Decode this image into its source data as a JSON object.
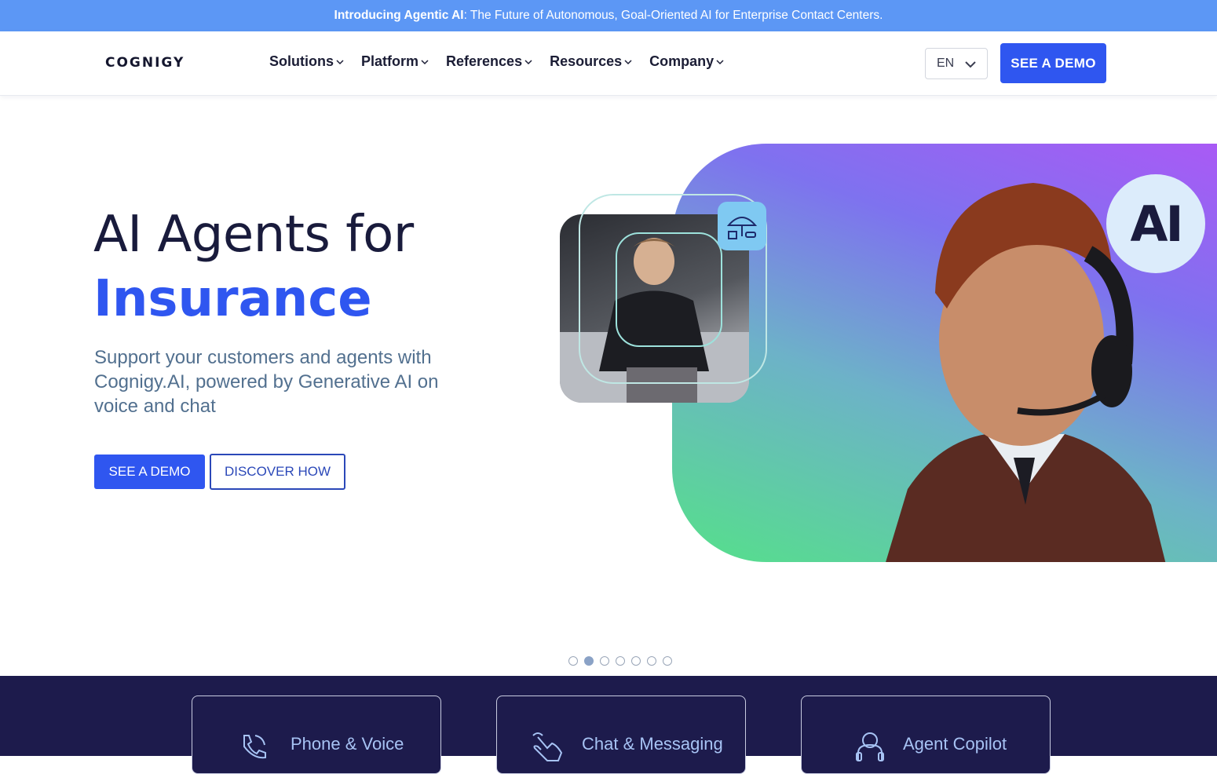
{
  "announcement": {
    "bold": "Introducing Agentic AI",
    "rest": ": The Future of Autonomous, Goal-Oriented AI for Enterprise Contact Centers."
  },
  "header": {
    "logo": "COGNIGY",
    "nav": [
      {
        "label": "Solutions"
      },
      {
        "label": "Platform"
      },
      {
        "label": "References"
      },
      {
        "label": "Resources"
      },
      {
        "label": "Company"
      }
    ],
    "language": "EN",
    "demo_label": "SEE A DEMO"
  },
  "hero": {
    "title": "AI Agents for",
    "accent": "Insurance",
    "subtitle": "Support your customers and agents with Cognigy.AI, powered by Generative AI on voice and chat",
    "primary_cta": "SEE A DEMO",
    "secondary_cta": "DISCOVER HOW",
    "badge": "AI"
  },
  "carousel": {
    "count": 7,
    "active_index": 1
  },
  "cards": [
    {
      "label": "Phone & Voice",
      "icon": "phone-icon"
    },
    {
      "label": "Chat & Messaging",
      "icon": "tap-hand-icon"
    },
    {
      "label": "Agent Copilot",
      "icon": "headset-ai-icon"
    }
  ],
  "colors": {
    "primary": "#2f56f0",
    "navy": "#1d1b4c",
    "announce": "#5c97f5"
  }
}
